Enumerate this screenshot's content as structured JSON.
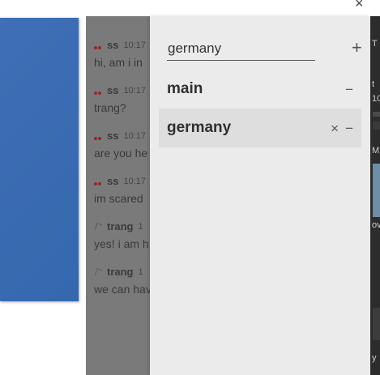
{
  "window": {
    "close_glyph": "×"
  },
  "chat": {
    "messages": [
      {
        "user": "ss",
        "time": "10:17",
        "text": "hi, am i in",
        "icon": "cherry-icon"
      },
      {
        "user": "ss",
        "time": "10:17",
        "text": "trang?",
        "icon": "cherry-icon"
      },
      {
        "user": "ss",
        "time": "10:17",
        "text": "are you he",
        "icon": "cherry-icon"
      },
      {
        "user": "ss",
        "time": "10:17",
        "text": "im scared",
        "icon": "cherry-icon"
      },
      {
        "user": "trang",
        "time": "1",
        "text": "yes! i am h",
        "icon": "leaf-icon"
      },
      {
        "user": "trang",
        "time": "1",
        "text": "we can hav",
        "icon": "leaf-icon"
      }
    ]
  },
  "channels": {
    "search": {
      "value": "germany",
      "placeholder": ""
    },
    "add_glyph": "+",
    "items": [
      {
        "label": "main",
        "remove_glyph": "−"
      },
      {
        "label": "germany",
        "close_glyph": "×",
        "remove_glyph": "−"
      }
    ]
  },
  "right_edge": {
    "chars": [
      "T",
      "t",
      "10",
      "M",
      "ov",
      "y"
    ]
  }
}
